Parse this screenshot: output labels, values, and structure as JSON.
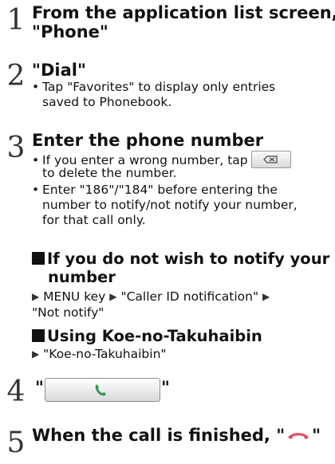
{
  "steps": [
    {
      "num": "1",
      "title_l1": "From the application list screen,",
      "title_l2": "\"Phone\""
    },
    {
      "num": "2",
      "title": "\"Dial\"",
      "bullet_l1": "Tap \"Favorites\" to display only entries",
      "bullet_l2": "saved to Phonebook."
    },
    {
      "num": "3",
      "title": "Enter the phone number",
      "b1_l1": "If you enter a wrong number, tap",
      "b1_l2": "to delete the number.",
      "b2_l1": "Enter \"186\"/\"184\" before entering the",
      "b2_l2": "number to notify/not notify your number,",
      "b2_l3": "for that call only."
    },
    {
      "num": "4",
      "quote_open": "\"",
      "quote_close": "\""
    },
    {
      "num": "5",
      "title_text": "When the call is finished, \"",
      "title_close": "\""
    }
  ],
  "notify_section": {
    "heading_l1": "If you do not wish to notify your",
    "heading_l2": "number",
    "key": "MENU key",
    "option1": "\"Caller ID notification\"",
    "option2": "\"Not notify\""
  },
  "koe_section": {
    "heading": "Using Koe-no-Takuhaibin",
    "option": "\"Koe-no-Takuhaibin\""
  },
  "icons": {
    "call_handset_color": "#2e9a4f",
    "end_handset_color": "#e0506a"
  }
}
